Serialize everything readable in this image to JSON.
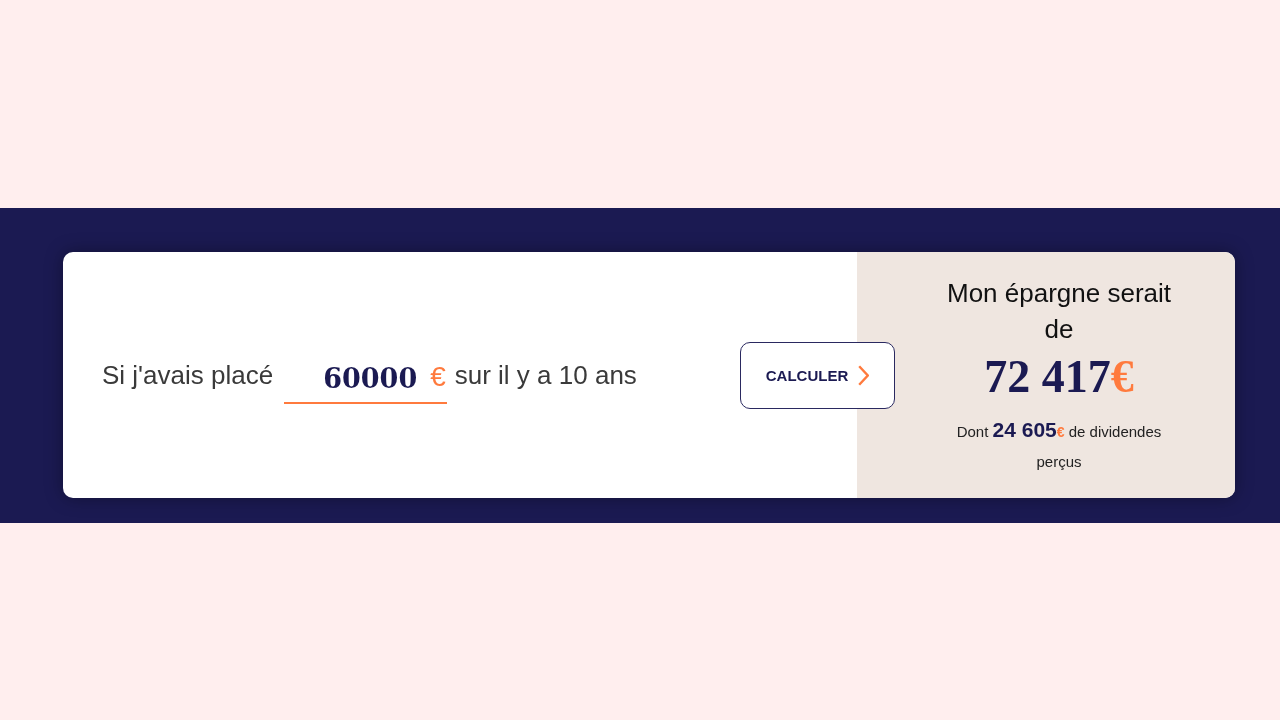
{
  "calculator": {
    "prefix": "Si j'avais placé",
    "amount_field": {
      "value": "60000",
      "currency": "€"
    },
    "suffix": "sur il y a 10 ans",
    "button": {
      "label": "CALCULER"
    }
  },
  "result": {
    "title": "Mon épargne serait de",
    "total": {
      "amount": "72 417",
      "currency": "€"
    },
    "detail": {
      "lead": "Dont",
      "amount": "24 605",
      "currency": "€",
      "tail": "de dividendes perçus"
    }
  }
}
